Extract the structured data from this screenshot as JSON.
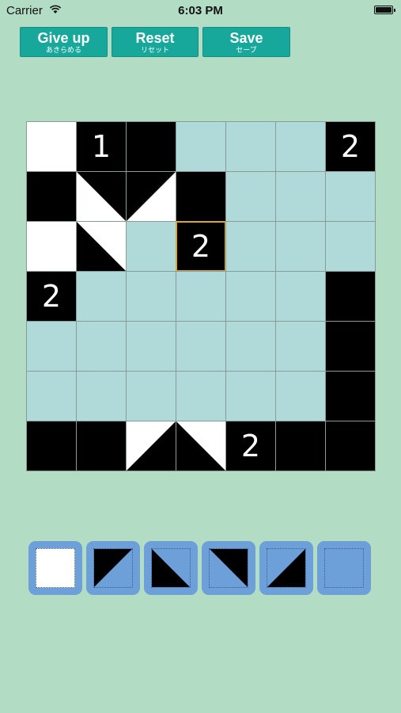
{
  "status_bar": {
    "carrier": "Carrier",
    "time": "6:03 PM"
  },
  "toolbar": [
    {
      "label": "Give up",
      "sub": "あきらめる"
    },
    {
      "label": "Reset",
      "sub": "リセット"
    },
    {
      "label": "Save",
      "sub": "セーブ"
    }
  ],
  "colors": {
    "background": "#b3dcc4",
    "button": "#18a89b",
    "empty_cell": "#b0dad9",
    "filled": "#000000",
    "white": "#ffffff",
    "selection": "#e2a62a",
    "palette": "#6d9fd8"
  },
  "puzzle": {
    "size": 7,
    "selected": [
      2,
      3
    ],
    "cells": [
      [
        "white",
        "num:1",
        "black",
        "empty",
        "empty",
        "empty",
        "num:2"
      ],
      [
        "black",
        "tri-ur",
        "tri-ul",
        "black",
        "empty",
        "empty",
        "empty"
      ],
      [
        "white",
        "tri-ll",
        "empty",
        "num:2",
        "empty",
        "empty",
        "empty"
      ],
      [
        "num:2",
        "empty",
        "empty",
        "empty",
        "empty",
        "empty",
        "black"
      ],
      [
        "empty",
        "empty",
        "empty",
        "empty",
        "empty",
        "empty",
        "black"
      ],
      [
        "empty",
        "empty",
        "empty",
        "empty",
        "empty",
        "empty",
        "black"
      ],
      [
        "black",
        "black",
        "tri-lr",
        "tri-ll",
        "num:2",
        "black",
        "black"
      ]
    ]
  },
  "palette": [
    {
      "name": "white-tool",
      "shape": "white"
    },
    {
      "name": "triangle-upper-left-tool",
      "shape": "tri-ul"
    },
    {
      "name": "triangle-lower-left-tool",
      "shape": "tri-ll"
    },
    {
      "name": "triangle-upper-right-tool",
      "shape": "tri-ur"
    },
    {
      "name": "triangle-lower-right-tool",
      "shape": "tri-lr"
    },
    {
      "name": "clear-tool",
      "shape": "empty"
    }
  ]
}
